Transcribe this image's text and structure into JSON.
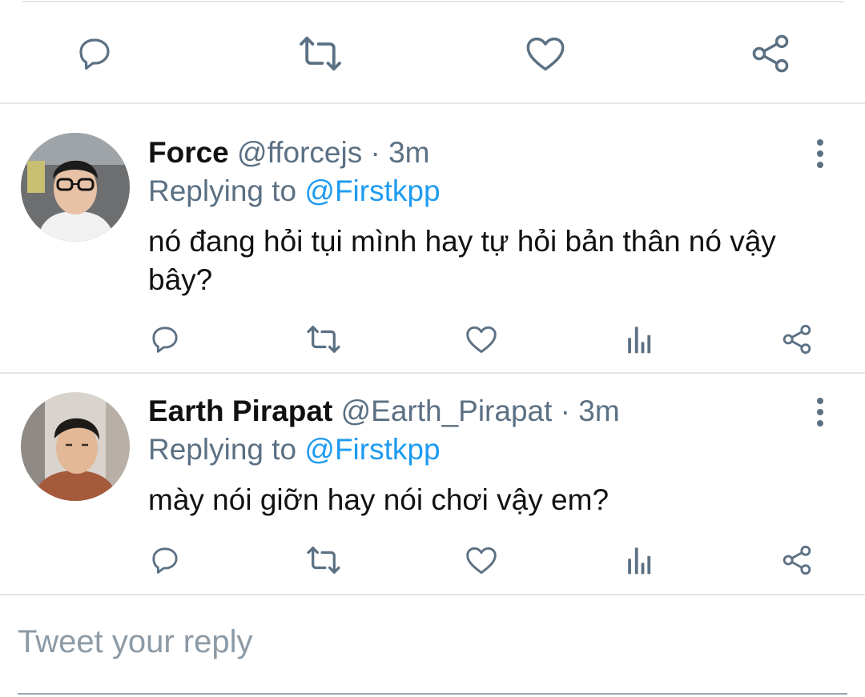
{
  "top_actions": {
    "icons": [
      "reply-icon",
      "retweet-icon",
      "like-icon",
      "share-icon"
    ]
  },
  "replies": [
    {
      "name": "Force",
      "handle": "@fforcejs",
      "time": "3m",
      "replying_prefix": "Replying to",
      "replying_to": "@Firstkpp",
      "text": "nó đang hỏi tụi mình hay tự hỏi bản thân nó vậy bây?"
    },
    {
      "name": "Earth Pirapat",
      "handle": "@Earth_Pirapat",
      "time": "3m",
      "replying_prefix": "Replying to",
      "replying_to": "@Firstkpp",
      "text": "mày nói giỡn hay nói chơi vậy em?"
    }
  ],
  "reply_box": {
    "placeholder": "Tweet your reply"
  },
  "colors": {
    "icon_gray": "#5b7083",
    "mention_blue": "#1d9bf0",
    "divider": "#e1e6ea"
  }
}
